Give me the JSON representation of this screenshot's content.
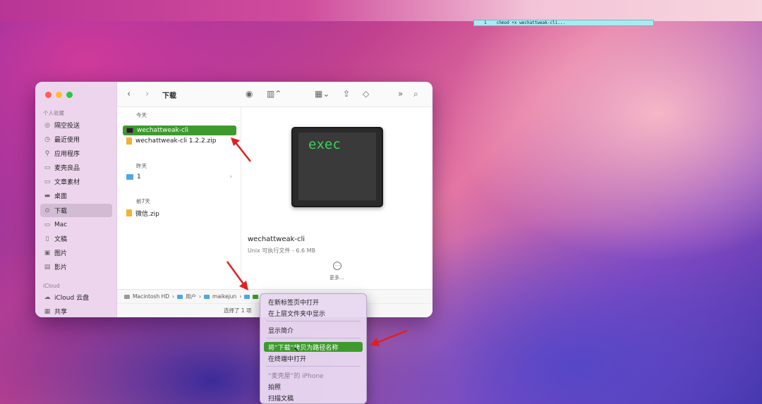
{
  "terminal": {
    "line_no": "1",
    "command": "chmod +x wechattweak-cli..."
  },
  "finder": {
    "title": "下载",
    "sidebar": {
      "sections": [
        {
          "label": "个人收藏",
          "items": [
            {
              "label": "隔空投送",
              "icon": "airdrop-icon"
            },
            {
              "label": "最近使用",
              "icon": "clock-icon"
            },
            {
              "label": "应用程序",
              "icon": "apps-icon"
            },
            {
              "label": "麦壳良品",
              "icon": "folder-icon"
            },
            {
              "label": "文章素材",
              "icon": "folder-icon"
            },
            {
              "label": "桌面",
              "icon": "desktop-icon"
            },
            {
              "label": "下载",
              "icon": "download-icon",
              "active": true
            },
            {
              "label": "Mac",
              "icon": "folder-icon"
            },
            {
              "label": "文稿",
              "icon": "document-icon"
            },
            {
              "label": "图片",
              "icon": "photo-icon"
            },
            {
              "label": "影片",
              "icon": "film-icon"
            }
          ]
        },
        {
          "label": "iCloud",
          "items": [
            {
              "label": "iCloud 云盘",
              "icon": "cloud-icon"
            },
            {
              "label": "共享",
              "icon": "shared-icon"
            }
          ]
        }
      ]
    },
    "groups": [
      {
        "heading": "今天",
        "files": [
          {
            "name": "wechattweak-cli",
            "kind": "exec",
            "selected": true
          },
          {
            "name": "wechattweak-cli 1.2.2.zip",
            "kind": "zip"
          }
        ]
      },
      {
        "heading": "昨天",
        "files": [
          {
            "name": "1",
            "kind": "folder"
          }
        ]
      },
      {
        "heading": "前7天",
        "files": [
          {
            "name": "微信.zip",
            "kind": "zip"
          }
        ]
      }
    ],
    "preview": {
      "icon_text": "exec",
      "name": "wechattweak-cli",
      "info": "Unix 可执行文件 - 6.6 MB",
      "more_label": "更多..."
    },
    "path": [
      "Macintosh HD",
      "用户",
      "maikejun"
    ],
    "status": "选择了 1 项"
  },
  "context_menu": {
    "items": [
      {
        "label": "在新标签页中打开"
      },
      {
        "label": "在上层文件夹中显示"
      },
      {
        "sep": true
      },
      {
        "label": "显示简介"
      },
      {
        "sep": true
      },
      {
        "label": "将“下载”拷贝为路径名称",
        "highlighted": true
      },
      {
        "label": "在终端中打开"
      },
      {
        "sep": true
      },
      {
        "label": "“麦壳屋”的 iPhone",
        "disabled": true
      },
      {
        "label": "拍照"
      },
      {
        "label": "扫描文稿"
      }
    ]
  },
  "colors": {
    "selection": "#3e9a2e",
    "annotation_arrow": "#e02020"
  }
}
